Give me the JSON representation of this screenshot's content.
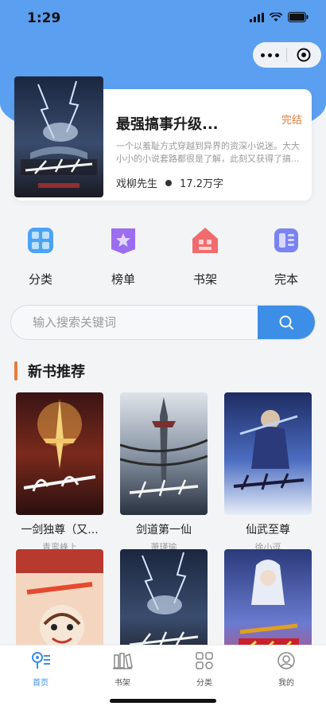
{
  "status_bar": {
    "time": "1:29"
  },
  "featured": {
    "title": "最强搞事升级...",
    "status": "完结",
    "description": "一个以羞耻方式穿越到异界的资深小说迷。大大小小的小说套路都很是了解，此刻又获得了搞...",
    "author": "戏柳先生",
    "word_count": "17.2万字"
  },
  "nav": [
    {
      "label": "分类",
      "icon": "grid-icon",
      "color": "#4aa3f3"
    },
    {
      "label": "榜单",
      "icon": "ranking-star-icon",
      "color": "#9b6df0"
    },
    {
      "label": "书架",
      "icon": "bookshelf-house-icon",
      "color": "#f06b6b"
    },
    {
      "label": "完本",
      "icon": "finished-book-icon",
      "color": "#7b83f0"
    }
  ],
  "search": {
    "placeholder": "输入搜索关键词",
    "value": ""
  },
  "section": {
    "title": "新书推荐"
  },
  "books": [
    {
      "title": "一剑独尊（又...",
      "author": "青鸾峰上"
    },
    {
      "title": "剑道第一仙",
      "author": "萧瑾瑜"
    },
    {
      "title": "仙武至尊",
      "author": "徐小逗"
    },
    {
      "title": "",
      "author": ""
    },
    {
      "title": "",
      "author": ""
    },
    {
      "title": "",
      "author": ""
    }
  ],
  "tabbar": [
    {
      "label": "首页",
      "icon": "home-icon",
      "active": true
    },
    {
      "label": "书架",
      "icon": "bookshelf-icon",
      "active": false
    },
    {
      "label": "分类",
      "icon": "category-icon",
      "active": false
    },
    {
      "label": "我的",
      "icon": "profile-icon",
      "active": false
    }
  ],
  "colors": {
    "hero": "#5b9ff0",
    "accent": "#3c8ee6",
    "orange": "#e87b3a"
  }
}
